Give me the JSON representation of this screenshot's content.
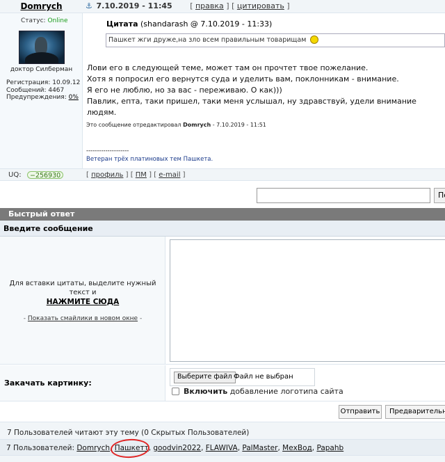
{
  "post": {
    "author": "Domrych",
    "status_label": "Статус:",
    "status_value": "Online",
    "avatar_caption": "доктор Силберман",
    "registration": "Регистрация: 10.09.12",
    "messages": "Сообщений: 4467",
    "warnings_label": "Предупреждения:",
    "warnings_value": "0%",
    "date": "7.10.2019 - 11:45",
    "action_edit": "правка",
    "action_quote": "цитировать",
    "quote": {
      "label": "Цитата",
      "source": "(shandarash @ 7.10.2019 - 11:33)",
      "text": "Пашкет жги друже,на зло всем правильным товарищам"
    },
    "body": [
      "Лови его в следующей теме, может там он прочтет твое пожелание.",
      "Хотя я попросил его вернутся суда и уделить вам, поклонникам - внимание.",
      "Я его не люблю, но за вас - переживаю. О как)))",
      "Павлик, епта, таки пришел, таки меня услышал, ну здравствуй, удели внимание людям."
    ],
    "edit_note_prefix": "Это сообщение отредактировал",
    "edit_note_user": "Domrych",
    "edit_note_date": "- 7.10.2019 - 11:51",
    "signature_sep": "--------------------",
    "signature": "Ветеран трёх платиновых тем Пашкета.",
    "uq_label": "UQ:",
    "uq_value": "−256930",
    "footer_profile": "профиль",
    "footer_pm": "ПМ",
    "footer_email": "e-mail"
  },
  "search": {
    "button_label": "По"
  },
  "quick_reply": {
    "header": "Быстрый ответ",
    "enter_message": "Введите сообщение",
    "hint_line1": "Для вставки цитаты, выделите нужный",
    "hint_line2": "текст и",
    "click_here": "НАЖМИТЕ СЮДА",
    "smileys_link": "Показать смайлики в новом окне",
    "upload_label": "Закачать картинку:",
    "choose_file": "Выберите файл",
    "no_file": "Файл не выбран",
    "logo_bold": "Включить",
    "logo_rest": "добавление логотипа сайта",
    "send": "Отправить",
    "preview": "Предварительный"
  },
  "online": {
    "title": "7 Пользователей читают эту тему (0 Скрытых Пользователей)",
    "users_label": "7 Пользователей:",
    "users": [
      "Domrych",
      "Пашкетт",
      "goodvin2022",
      "FLAWIVA",
      "PalMaster",
      "МехВод",
      "Papahb"
    ]
  },
  "colors": {
    "online_green": "#1a9c1a",
    "header_gray": "#7a7a7a",
    "annotation_red": "#e02424"
  }
}
